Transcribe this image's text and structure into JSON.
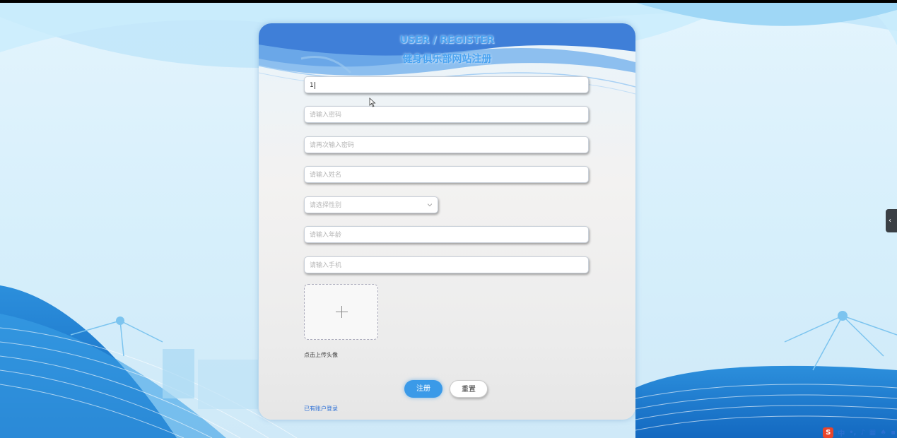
{
  "header": {
    "title_en": "USER / REGISTER",
    "title_cn": "健身俱乐部网站注册"
  },
  "form": {
    "account_value": "1",
    "password_placeholder": "请输入密码",
    "confirm_password_placeholder": "请再次输入密码",
    "name_placeholder": "请输入姓名",
    "gender_placeholder": "请选择性别",
    "age_placeholder": "请输入年龄",
    "phone_placeholder": "请输入手机",
    "avatar_hint": "点击上传头像"
  },
  "actions": {
    "register_label": "注册",
    "reset_label": "重置",
    "login_link": "已有账户登录"
  },
  "icons": {
    "upload": "plus-icon",
    "select": "chevron-down-icon",
    "side_toggle": "chevron-left-icon",
    "cursor": "mouse-pointer-icon"
  },
  "tray": {
    "ime_label": "中"
  },
  "colors": {
    "accent": "#3b9ae8",
    "title": "#4aa3f0",
    "link": "#2b6fd6"
  }
}
